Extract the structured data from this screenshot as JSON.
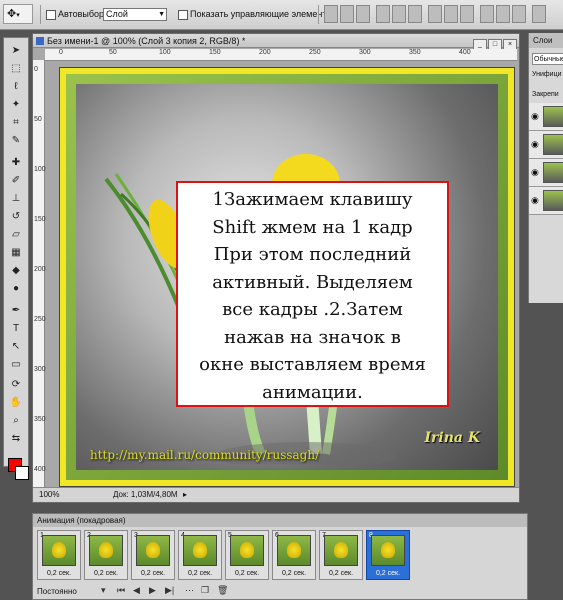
{
  "options_bar": {
    "auto_select_label": "Автовыбор:",
    "auto_select_value": "Слой",
    "show_controls_label": "Показать управляющие элементы"
  },
  "document": {
    "title": "Без имени-1 @ 100% (Слой 3 копия 2, RGB/8) *",
    "status_zoom": "100%",
    "status_doc": "Док: 1,03M/4,80M",
    "ruler_h": [
      "0",
      "50",
      "100",
      "150",
      "200",
      "250",
      "300",
      "350",
      "400"
    ],
    "ruler_v": [
      "0",
      "50",
      "100",
      "150",
      "200",
      "250",
      "300",
      "350",
      "400"
    ]
  },
  "artwork": {
    "url_text": "http://my.mail.ru/community/russagh/",
    "signature": "Irina K",
    "instruction_lines": [
      "1Зажимаем клавишу",
      "Shift жмем на 1 кадр",
      "При этом последний",
      "активный. Выделяем",
      "все кадры .2.Затем",
      "нажав на значок в",
      "окне выставляем время",
      "анимации."
    ]
  },
  "layers_panel": {
    "tab": "Слои",
    "blend_mode": "Обычные",
    "unify_label": "Унифици",
    "lock_label": "Закрепи"
  },
  "animation_panel": {
    "title": "Анимация (покадровая)",
    "loop": "Постоянно",
    "frames": [
      {
        "num": "1",
        "duration": "0,2 сек."
      },
      {
        "num": "2",
        "duration": "0,2 сек."
      },
      {
        "num": "3",
        "duration": "0,2 сек."
      },
      {
        "num": "4",
        "duration": "0,2 сек."
      },
      {
        "num": "5",
        "duration": "0,2 сек."
      },
      {
        "num": "6",
        "duration": "0,2 сек."
      },
      {
        "num": "7",
        "duration": "0,2 сек."
      },
      {
        "num": "8",
        "duration": "0,2 сек."
      }
    ],
    "selected_frame": 8
  },
  "colors": {
    "foreground": "#ff0000",
    "background": "#ffffff",
    "frame_yellow": "#f0e826",
    "textbox_border": "#dd1111"
  }
}
